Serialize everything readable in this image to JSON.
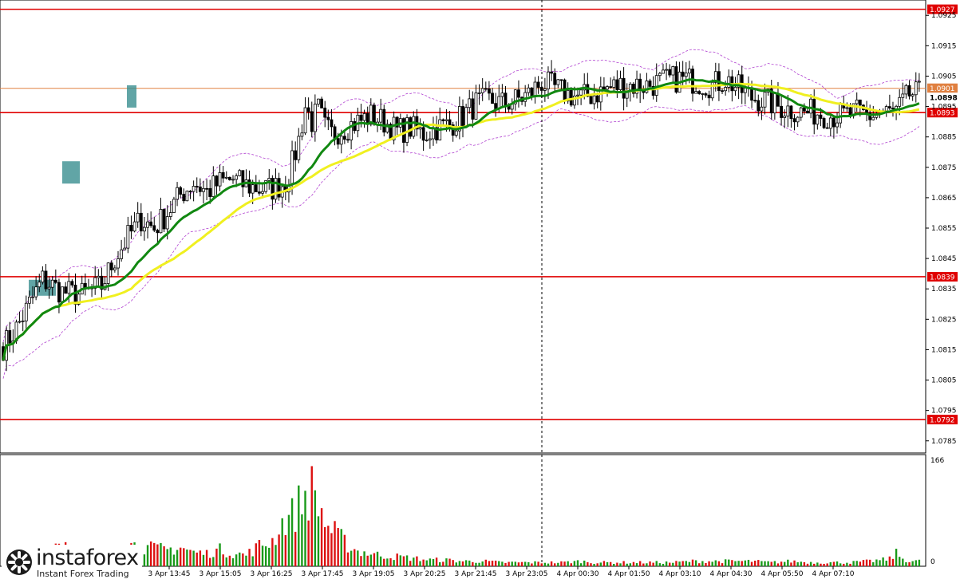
{
  "chart_data": {
    "type": "candlestick",
    "symbol": "",
    "y_ticks": [
      "1.0925",
      "1.0915",
      "1.0905",
      "1.0895",
      "1.0885",
      "1.0875",
      "1.0865",
      "1.0855",
      "1.0845",
      "1.0835",
      "1.0825",
      "1.0815",
      "1.0805",
      "1.0795",
      "1.0785"
    ],
    "x_ticks": [
      "3 Apr 13:45",
      "3 Apr 15:05",
      "3 Apr 16:25",
      "3 Apr 17:45",
      "3 Apr 19:05",
      "3 Apr 20:25",
      "3 Apr 21:45",
      "3 Apr 23:05",
      "4 Apr 00:30",
      "4 Apr 01:50",
      "4 Apr 03:10",
      "4 Apr 04:30",
      "4 Apr 05:50",
      "4 Apr 07:10"
    ],
    "ylim": [
      1.0781,
      1.0929
    ],
    "levels": [
      {
        "value": 1.0927,
        "label": "1.0927",
        "color": "#e00000"
      },
      {
        "value": 1.0893,
        "label": "1.0893",
        "color": "#e00000"
      },
      {
        "value": 1.0839,
        "label": "1.0839",
        "color": "#e00000"
      },
      {
        "value": 1.0792,
        "label": "1.0792",
        "color": "#e00000"
      },
      {
        "value": 1.0901,
        "label": "1.0901",
        "color": "#e08040"
      }
    ],
    "current_price": "1.0898",
    "ma_fast_color": "#118811",
    "ma_slow_color": "#f0f020",
    "bands_color": "#b040d0",
    "bull_color": "#000000",
    "bear_color": "#000000",
    "volume": {
      "max_label": "166",
      "zero_label": "0",
      "up_color": "#1a9a1a",
      "down_color": "#dd1111"
    },
    "price_path": [
      [
        0,
        1.0816
      ],
      [
        4,
        1.0822
      ],
      [
        8,
        1.083
      ],
      [
        12,
        1.0838
      ],
      [
        18,
        1.0834
      ],
      [
        24,
        1.0833
      ],
      [
        30,
        1.0836
      ],
      [
        34,
        1.0845
      ],
      [
        38,
        1.0852
      ],
      [
        42,
        1.0858
      ],
      [
        46,
        1.0855
      ],
      [
        50,
        1.086
      ],
      [
        54,
        1.0866
      ],
      [
        58,
        1.087
      ],
      [
        62,
        1.0867
      ],
      [
        66,
        1.087
      ],
      [
        70,
        1.0871
      ],
      [
        74,
        1.0869
      ],
      [
        78,
        1.0868
      ],
      [
        82,
        1.0868
      ],
      [
        86,
        1.087
      ],
      [
        88,
        1.0876
      ],
      [
        90,
        1.0884
      ],
      [
        92,
        1.0895
      ],
      [
        94,
        1.089
      ],
      [
        96,
        1.0894
      ],
      [
        98,
        1.0888
      ],
      [
        100,
        1.0886
      ],
      [
        104,
        1.0888
      ],
      [
        108,
        1.089
      ],
      [
        112,
        1.0892
      ],
      [
        116,
        1.089
      ],
      [
        120,
        1.0887
      ],
      [
        124,
        1.0888
      ],
      [
        128,
        1.0886
      ],
      [
        132,
        1.0888
      ],
      [
        136,
        1.0889
      ],
      [
        140,
        1.0892
      ],
      [
        144,
        1.0896
      ],
      [
        148,
        1.0897
      ],
      [
        152,
        1.0896
      ],
      [
        156,
        1.0897
      ],
      [
        160,
        1.0899
      ],
      [
        164,
        1.0903
      ],
      [
        168,
        1.0901
      ],
      [
        172,
        1.0899
      ],
      [
        176,
        1.0898
      ],
      [
        180,
        1.0899
      ],
      [
        184,
        1.0901
      ],
      [
        188,
        1.0902
      ],
      [
        192,
        1.0902
      ],
      [
        196,
        1.0902
      ],
      [
        200,
        1.0903
      ],
      [
        204,
        1.0904
      ],
      [
        208,
        1.0904
      ],
      [
        212,
        1.0903
      ],
      [
        216,
        1.0902
      ],
      [
        220,
        1.0904
      ],
      [
        224,
        1.0901
      ],
      [
        228,
        1.0898
      ],
      [
        232,
        1.0897
      ],
      [
        236,
        1.0895
      ],
      [
        240,
        1.0894
      ],
      [
        244,
        1.0893
      ],
      [
        248,
        1.0893
      ],
      [
        252,
        1.0892
      ],
      [
        256,
        1.0892
      ],
      [
        260,
        1.0893
      ],
      [
        264,
        1.0892
      ],
      [
        268,
        1.0893
      ],
      [
        272,
        1.0893
      ],
      [
        276,
        1.0899
      ]
    ],
    "volume_path": [
      [
        0,
        18
      ],
      [
        6,
        20
      ],
      [
        10,
        22
      ],
      [
        14,
        30
      ],
      [
        18,
        42
      ],
      [
        22,
        26
      ],
      [
        26,
        20
      ],
      [
        30,
        24
      ],
      [
        34,
        22
      ],
      [
        38,
        36
      ],
      [
        42,
        30
      ],
      [
        46,
        28
      ],
      [
        50,
        26
      ],
      [
        54,
        30
      ],
      [
        58,
        22
      ],
      [
        62,
        20
      ],
      [
        66,
        26
      ],
      [
        70,
        20
      ],
      [
        74,
        18
      ],
      [
        78,
        32
      ],
      [
        82,
        40
      ],
      [
        84,
        60
      ],
      [
        86,
        74
      ],
      [
        88,
        80
      ],
      [
        90,
        96
      ],
      [
        92,
        110
      ],
      [
        94,
        120
      ],
      [
        96,
        98
      ],
      [
        98,
        70
      ],
      [
        100,
        56
      ],
      [
        102,
        48
      ],
      [
        104,
        38
      ],
      [
        106,
        30
      ],
      [
        108,
        24
      ],
      [
        110,
        22
      ],
      [
        114,
        18
      ],
      [
        118,
        16
      ],
      [
        122,
        14
      ],
      [
        126,
        12
      ],
      [
        130,
        10
      ],
      [
        134,
        10
      ],
      [
        140,
        8
      ],
      [
        146,
        8
      ],
      [
        152,
        6
      ],
      [
        158,
        6
      ],
      [
        164,
        6
      ],
      [
        170,
        6
      ],
      [
        176,
        8
      ],
      [
        180,
        6
      ],
      [
        186,
        6
      ],
      [
        192,
        6
      ],
      [
        198,
        6
      ],
      [
        204,
        6
      ],
      [
        210,
        8
      ],
      [
        216,
        8
      ],
      [
        222,
        8
      ],
      [
        228,
        8
      ],
      [
        234,
        6
      ],
      [
        240,
        8
      ],
      [
        246,
        6
      ],
      [
        252,
        6
      ],
      [
        258,
        6
      ],
      [
        264,
        8
      ],
      [
        268,
        10
      ],
      [
        270,
        12
      ],
      [
        272,
        20
      ],
      [
        274,
        12
      ],
      [
        276,
        8
      ]
    ]
  },
  "logo": {
    "word": "instaforex",
    "tagline": "Instant Forex Trading"
  }
}
